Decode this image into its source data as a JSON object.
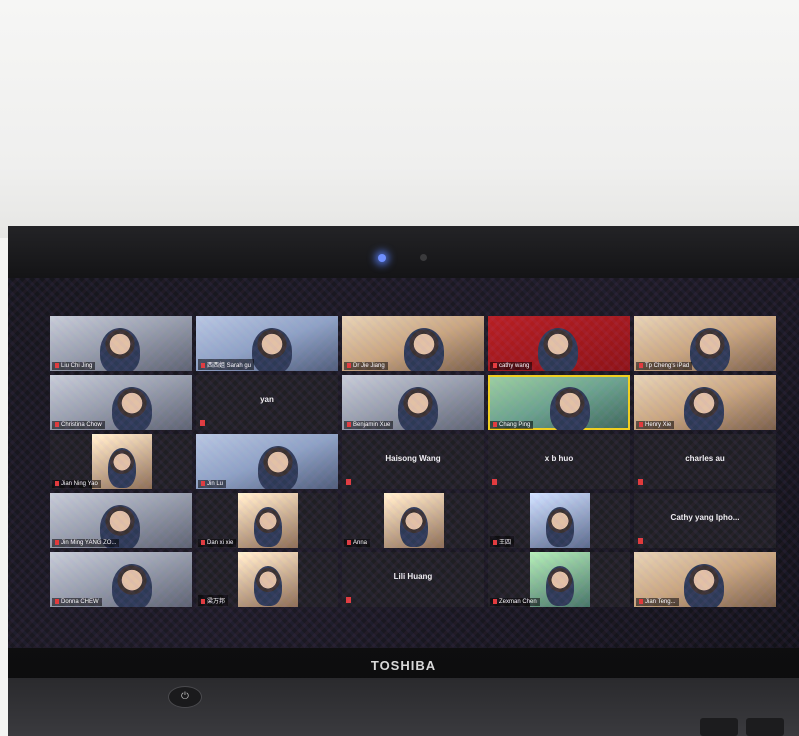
{
  "brand": "TOSHIBA",
  "tiles": [
    {
      "name": "Liu Chi Jing",
      "style": "photo"
    },
    {
      "name": "西西姐 Sarah gu",
      "style": "cool"
    },
    {
      "name": "Dr Jie Jiang",
      "style": "warm"
    },
    {
      "name": "cathy wang",
      "style": "red"
    },
    {
      "name": "Tp Cheng's iPad",
      "style": "warm"
    },
    {
      "name": "Christina Chow",
      "style": "photo"
    },
    {
      "name": "yan",
      "style": "dark-center"
    },
    {
      "name": "Benjamin Xue",
      "style": "photo"
    },
    {
      "name": "Chang Ping",
      "style": "green",
      "active": true
    },
    {
      "name": "Henry Xie",
      "style": "warm"
    },
    {
      "name": "Jian Ning Yao",
      "style": "warm-small"
    },
    {
      "name": "Jin Lu",
      "style": "cool"
    },
    {
      "name": "Haisong Wang",
      "style": "dark-center"
    },
    {
      "name": "x b huo",
      "style": "dark-center"
    },
    {
      "name": "charles au",
      "style": "dark-center"
    },
    {
      "name": "Jin Ming YANG ZO...",
      "style": "photo"
    },
    {
      "name": "Dan xi xie",
      "style": "warm-small"
    },
    {
      "name": "Anna",
      "style": "warm-small"
    },
    {
      "name": "王四",
      "style": "cool-small"
    },
    {
      "name": "Cathy yang Ipho...",
      "style": "dark-center"
    },
    {
      "name": "Donna CHEW",
      "style": "photo"
    },
    {
      "name": "梁万邦",
      "style": "warm-small"
    },
    {
      "name": "Lili Huang",
      "style": "dark-center"
    },
    {
      "name": "Zexman Chen",
      "style": "green-small"
    },
    {
      "name": "Jian Teng...",
      "style": "warm"
    }
  ]
}
